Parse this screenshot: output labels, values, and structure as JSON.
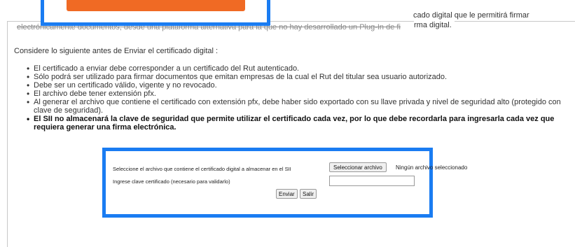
{
  "header": {
    "cert_line_1": "cado digital que le permitirá firmar",
    "cert_line_2": "rma digital.",
    "obscured_line": "electrónicamente documentos, desde una plataforma alternativa para la que no hay desarrollado un Plug-In de fi"
  },
  "intro": "Considere lo siguiente antes de Enviar el certificado digital :",
  "requirements": [
    "El certificado a enviar debe corresponder a un certificado del Rut autenticado.",
    "Sólo podrá ser utilizado para firmar documentos que emitan empresas de la cual el Rut del titular sea usuario autorizado.",
    "Debe ser un certificado válido, vigente y no revocado.",
    "El archivo debe tener extensión pfx.",
    "Al generar el archivo que contiene el certificado con extensión pfx, debe haber sido exportado con su llave privada y nivel de seguridad alto (protegido con clave de seguridad)."
  ],
  "warning": "El SII no almacenará la clave de seguridad que permite utilizar el certificado cada vez, por lo que debe recordarla para ingresarla cada vez que requiera generar una firma electrónica.",
  "form": {
    "file_label": "Seleccione el archivo que contiene el certificado digital a almacenar en el SII",
    "file_button": "Seleccionar archivo",
    "file_status": "Ningún archivo seleccionado",
    "password_label": "Ingrese clave certificado (necesario para validarlo)",
    "password_value": "",
    "submit_label": "Enviar",
    "exit_label": "Salir"
  },
  "colors": {
    "highlight": "#1a7cf2",
    "accent_orange": "#f06a24"
  }
}
